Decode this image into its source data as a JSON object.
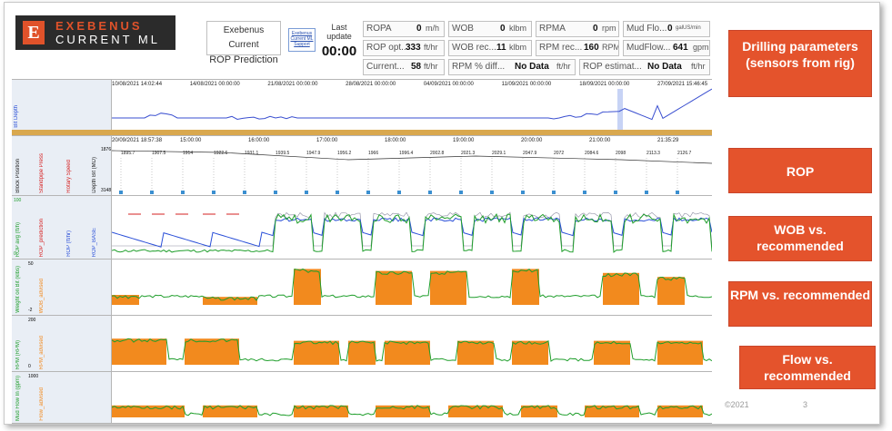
{
  "brand": {
    "line1": "EXEBENUS",
    "line2": "CURRENT ML",
    "mark": "E"
  },
  "header": {
    "app_title": "Exebenus Current",
    "view_title": "ROP Prediction",
    "small_button": "Exebenus Current ML Support",
    "last_update_label": "Last update",
    "last_update_value": "00:00"
  },
  "metrics": [
    {
      "label": "ROPA",
      "value": "0",
      "unit": "m/h"
    },
    {
      "label": "WOB",
      "value": "0",
      "unit": "klbm"
    },
    {
      "label": "RPMA",
      "value": "0",
      "unit": "rpm"
    },
    {
      "label": "Mud Flo...",
      "value": "0",
      "unit": "galUS/min"
    },
    {
      "label": "ROP opt...",
      "value": "333",
      "unit": "ft/hr"
    },
    {
      "label": "WOB rec...",
      "value": "11",
      "unit": "klbm"
    },
    {
      "label": "RPM rec...",
      "value": "160",
      "unit": "RPM"
    },
    {
      "label": "MudFlow...",
      "value": "641",
      "unit": "gpm"
    },
    {
      "label": "Current...",
      "value": "58",
      "unit": "ft/hr"
    },
    {
      "label": "RPM % diff...",
      "value": "No Data",
      "unit": "ft/hr"
    },
    {
      "label": "ROP estimat...",
      "value": "No Data",
      "unit": "ft/hr"
    }
  ],
  "overview_dates": [
    "10/08/2021 14:02:44",
    "14/08/2021 00:00:00",
    "21/08/2021 00:00:00",
    "28/08/2021 00:00:00",
    "04/09/2021 00:00:00",
    "11/09/2021 00:00:00",
    "18/09/2021 00:00:00",
    "27/09/2021 15:46:45"
  ],
  "detail_dates": [
    "20/09/2021 18:57:38",
    "15:00:00",
    "16:00:00",
    "17:00:00",
    "18:00:00",
    "19:00:00",
    "20:00:00",
    "21:00:00",
    "21:35:29"
  ],
  "lanes": {
    "overview_label": "Bit Depth",
    "depth_labels": [
      "Block Position",
      "Standpipe Press",
      "Rotary Speed",
      "Depth Bit (MD)"
    ],
    "rop_labels": [
      "ROP avg (ft/h)",
      "ROP_prediction",
      "ROP (ft/hr)",
      "ROP_BASE"
    ],
    "wob_labels": [
      "Weight on Bit (klbs)",
      "WOB_advised"
    ],
    "rpm_labels": [
      "RPM (RPM)",
      "RPM_advised"
    ],
    "flow_labels": [
      "Mud Flow In (gpm)",
      "Flow_advised"
    ],
    "scale_values": [
      "1876",
      "3148",
      "100",
      "0",
      "50",
      "-2",
      "200",
      "0",
      "1000"
    ]
  },
  "depth_values": [
    "1895.7",
    "1907.5",
    "1914",
    "1922.6",
    "1931.1",
    "1939.5",
    "1947.9",
    "1956.2",
    "1966",
    "1996.4",
    "2002.8",
    "2021.3",
    "2029.1",
    "2047.9",
    "2072",
    "2084.6",
    "2098",
    "2113.3",
    "2126.7"
  ],
  "annotations": [
    "Drilling parameters (sensors from rig)",
    "ROP",
    "WOB vs. recommended",
    "RPM vs. recommended",
    "Flow vs. recommended"
  ],
  "footer": {
    "copyright": "©2021",
    "page": "3"
  },
  "colors": {
    "accent": "#e4532c",
    "orange": "#f28a1e",
    "green": "#1f9e2b",
    "blue": "#2a4fd8"
  }
}
